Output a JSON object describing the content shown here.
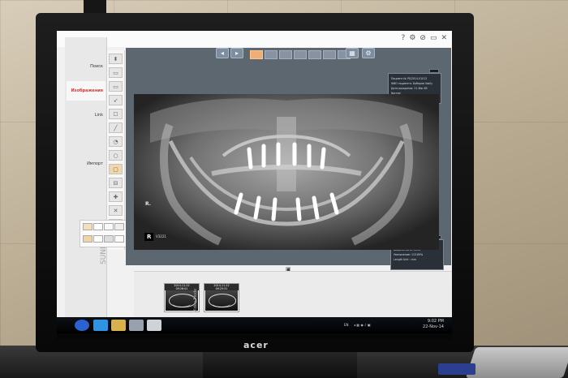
{
  "monitor": {
    "brand": "acer"
  },
  "window": {
    "controls": [
      "?",
      "⚙",
      "⊘",
      "▭",
      "✕"
    ]
  },
  "leftnav": {
    "items": [
      {
        "label": "Поиск",
        "active": false
      },
      {
        "label": "Изображения",
        "active": true
      },
      {
        "label": "Link",
        "active": false
      },
      {
        "label": "",
        "active": false
      },
      {
        "label": "Импорт",
        "active": false
      }
    ]
  },
  "tools": [
    "⬍",
    "▭",
    "▭",
    "➶",
    "☐",
    "╱",
    "◔",
    "○",
    "▢",
    "⊟",
    "✚",
    "✕",
    "⊞"
  ],
  "viewer": {
    "toolbar_left": [
      "◂",
      "▸"
    ],
    "toolbar_right": [
      "▦",
      "⚙"
    ],
    "info_top": {
      "lines": [
        "Пациент № PS/2014-01012",
        "ФИО пациента: Бобаров Vasily",
        "Дата рождения: 21-Mar-65",
        "Normal"
      ]
    },
    "info_bottom": {
      "lines": [
        "Центр окна: 2048",
        "Ширина окна: 4096",
        "Увеличение: 113.89%",
        "Length Unit : mm"
      ]
    },
    "xray": {
      "orientation_left": "R.",
      "orientation_badge": "R",
      "code": "V3221"
    }
  },
  "thumbs": {
    "vertical_label": "Video Mode",
    "items": [
      {
        "date": "2014-11-22",
        "time": "09:26:01"
      },
      {
        "date": "2014-11-22",
        "time": "09:25:51"
      }
    ]
  },
  "side_text": "SUNDOM",
  "taskbar": {
    "time": "9:02 PM",
    "date": "22-Nov-14",
    "lang": "EN"
  }
}
